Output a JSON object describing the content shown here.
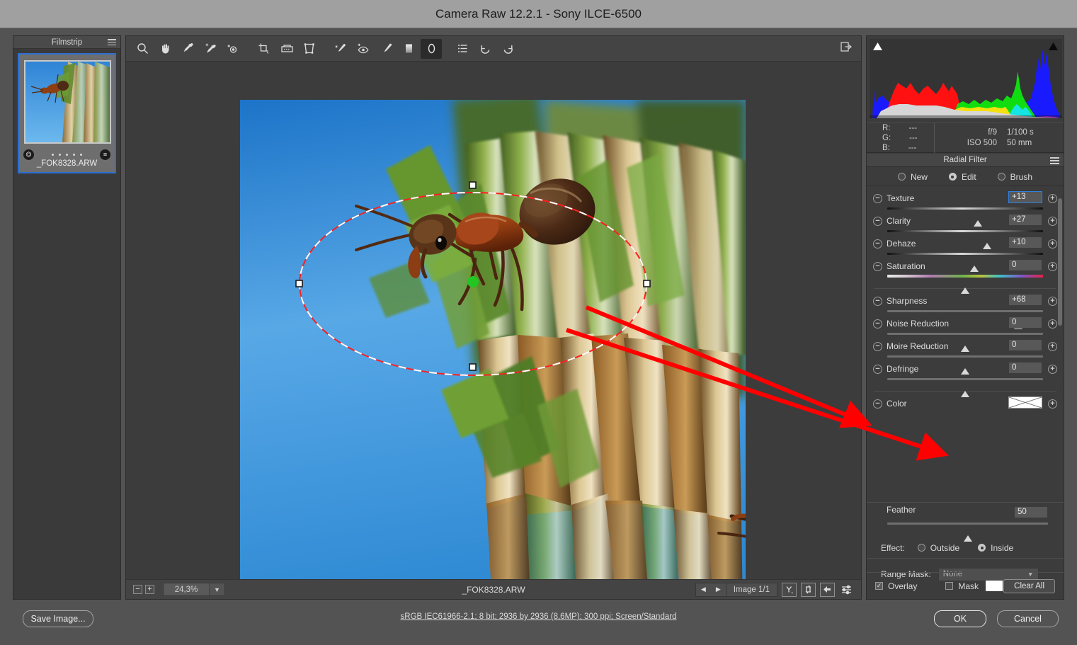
{
  "window": {
    "title": "Camera Raw 12.2.1  -  Sony ILCE-6500"
  },
  "filmstrip": {
    "title": "Filmstrip",
    "menu_icon": "hamburger-icon",
    "items": [
      {
        "filename": "_FOK8328.ARW",
        "crop_badge": "crop-icon",
        "settings_badge": "adjust-icon"
      }
    ]
  },
  "toolbar": {
    "tools": [
      {
        "name": "zoom-tool",
        "icon": "magnifier-icon",
        "active": false
      },
      {
        "name": "hand-tool",
        "icon": "hand-icon",
        "active": false
      },
      {
        "name": "white-balance-tool",
        "icon": "eyedropper-icon",
        "active": false
      },
      {
        "name": "color-sampler-tool",
        "icon": "eyedropper-sparkle-icon",
        "active": false
      },
      {
        "name": "targeted-adjustment-tool",
        "icon": "target-adjust-icon",
        "active": false
      },
      {
        "name": "crop-tool",
        "icon": "crop-icon",
        "active": false
      },
      {
        "name": "straighten-tool",
        "icon": "straighten-icon",
        "active": false
      },
      {
        "name": "transform-tool",
        "icon": "transform-grid-icon",
        "active": false
      },
      {
        "name": "spot-removal-tool",
        "icon": "spot-heal-icon",
        "active": false
      },
      {
        "name": "red-eye-tool",
        "icon": "red-eye-icon",
        "active": false
      },
      {
        "name": "adjustment-brush-tool",
        "icon": "brush-icon",
        "active": false
      },
      {
        "name": "graduated-filter-tool",
        "icon": "graduated-filter-icon",
        "active": false
      },
      {
        "name": "radial-filter-tool",
        "icon": "ellipse-icon",
        "active": true
      },
      {
        "name": "preferences-tool",
        "icon": "list-icon",
        "active": false
      },
      {
        "name": "rotate-ccw-tool",
        "icon": "rotate-left-icon",
        "active": false
      },
      {
        "name": "rotate-cw-tool",
        "icon": "rotate-right-icon",
        "active": false
      }
    ],
    "fullscreen_icon": "expand-panel-icon"
  },
  "statusbar": {
    "zoom_out_label": "−",
    "zoom_in_label": "+",
    "zoom_value": "24,3%",
    "zoom_dropdown_icon": "chevron-down-icon",
    "filename": "_FOK8328.ARW",
    "prev_icon": "triangle-left-icon",
    "next_icon": "triangle-right-icon",
    "pager_label": "Image 1/1",
    "buttons": [
      {
        "name": "filmstrip-sync-y-button",
        "icon": "y-badge-icon"
      },
      {
        "name": "sync-settings-button",
        "icon": "sync-arrows-icon"
      },
      {
        "name": "collapse-filmstrip-button",
        "icon": "arrow-left-icon"
      },
      {
        "name": "filmstrip-settings-button",
        "icon": "sliders-icon"
      }
    ]
  },
  "histogram": {
    "shadow_clip_icon": "triangle-white-icon",
    "highlight_clip_icon": "triangle-black-icon"
  },
  "exif": {
    "channels": [
      {
        "label": "R:",
        "value": "---"
      },
      {
        "label": "G:",
        "value": "---"
      },
      {
        "label": "B:",
        "value": "---"
      }
    ],
    "aperture": "f/9",
    "shutter": "1/100 s",
    "iso": "ISO 500",
    "focal": "50 mm"
  },
  "panel": {
    "title": "Radial Filter",
    "menu_icon": "hamburger-icon",
    "modes": [
      {
        "label": "New",
        "selected": false
      },
      {
        "label": "Edit",
        "selected": true
      },
      {
        "label": "Brush",
        "selected": false
      }
    ],
    "sliders_group_1": [
      {
        "label": "Texture",
        "value": "+13",
        "pos": 58,
        "track": "dark",
        "focused": true
      },
      {
        "label": "Clarity",
        "value": "+27",
        "pos": 64,
        "track": "dark",
        "focused": false
      },
      {
        "label": "Dehaze",
        "value": "+10",
        "pos": 56,
        "track": "dark",
        "focused": false
      },
      {
        "label": "Saturation",
        "value": "0",
        "pos": 50,
        "track": "rainbow",
        "focused": false
      }
    ],
    "sliders_group_2": [
      {
        "label": "Sharpness",
        "value": "+68",
        "pos": 84,
        "track": "flat",
        "focused": false
      },
      {
        "label": "Noise Reduction",
        "value": "0",
        "pos": 50,
        "track": "flat",
        "focused": false
      },
      {
        "label": "Moire Reduction",
        "value": "0",
        "pos": 50,
        "track": "flat",
        "focused": false
      },
      {
        "label": "Defringe",
        "value": "0",
        "pos": 50,
        "track": "flat",
        "focused": false
      }
    ],
    "color_row": {
      "label": "Color",
      "swatch": "none-swatch-icon"
    },
    "feather": {
      "label": "Feather",
      "value": "50",
      "pos": 50
    },
    "effect": {
      "label": "Effect:",
      "options": [
        {
          "label": "Outside",
          "selected": false
        },
        {
          "label": "Inside",
          "selected": true
        }
      ]
    },
    "range_mask": {
      "label": "Range Mask:",
      "value": "None",
      "chevron_icon": "chevron-down-icon"
    },
    "overlay": {
      "label": "Overlay",
      "checked": true
    },
    "mask": {
      "label": "Mask",
      "checked": false,
      "swatch_color": "#ffffff"
    },
    "clear_all": "Clear All"
  },
  "footer": {
    "save_image": "Save Image...",
    "workflow_options": "sRGB IEC61966-2.1; 8 bit; 2936 by 2936 (8,6MP); 300 ppi; Screen/Standard",
    "ok": "OK",
    "cancel": "Cancel"
  },
  "overlay_graphic": {
    "radial_pin": "green-pin-icon",
    "handles": [
      "handle-top",
      "handle-left",
      "handle-right",
      "handle-bottom"
    ],
    "annotation_color": "#ff0000"
  },
  "colors": {
    "accent": "#2c6fd1",
    "panel_bg": "#3c3c3c",
    "title_bg": "#a0a0a0",
    "pin_green": "#22c521"
  }
}
